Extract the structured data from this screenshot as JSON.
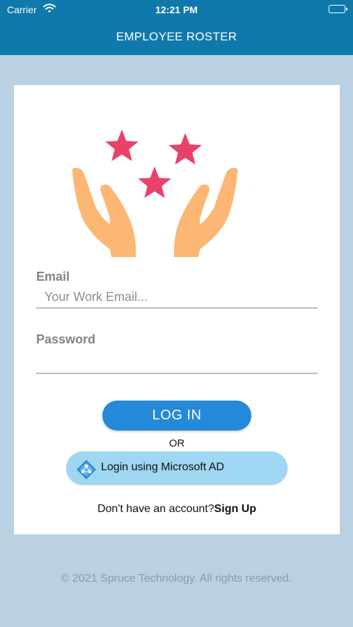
{
  "status_bar": {
    "carrier": "Carrier",
    "time": "12:21 PM"
  },
  "header": {
    "title": "EMPLOYEE ROSTER"
  },
  "form": {
    "email_label": "Email",
    "email_placeholder": "Your Work Email...",
    "email_value": "",
    "password_label": "Password",
    "password_value": "",
    "login_label": "LOG IN",
    "or_label": "OR",
    "ms_login_label": "Login using Microsoft AD",
    "signup_prompt": "Don't have an account?",
    "signup_link": "Sign Up"
  },
  "footer": {
    "text": "© 2021 Spruce Technology. All rights reserved."
  },
  "colors": {
    "header_bg": "#0f79ab",
    "page_bg": "#b9d1e3",
    "login_button": "#2389d8",
    "ms_button": "#9fd6f1",
    "star": "#e8426a",
    "hand": "#fdb775"
  },
  "icons": {
    "logo": "hands-with-stars-icon",
    "wifi": "wifi-icon",
    "battery": "battery-icon",
    "ms": "azure-ad-icon"
  }
}
